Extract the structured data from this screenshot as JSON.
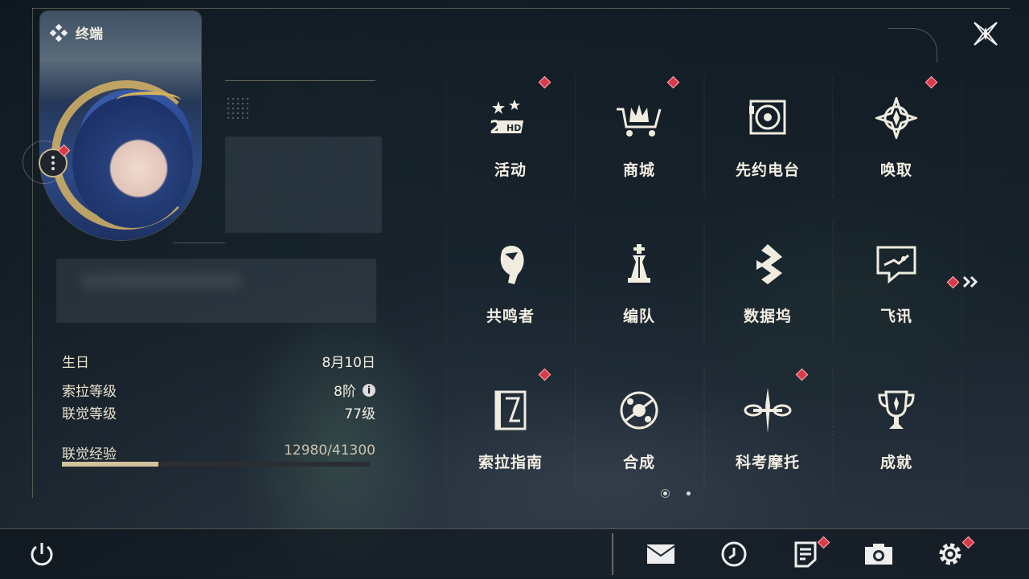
{
  "header": {
    "terminal_label": "终端"
  },
  "profile": {
    "birthday_label": "生日",
    "birthday_value": "8月10日",
    "sola_level_label": "索拉等级",
    "sola_level_value": "8阶",
    "union_level_label": "联觉等级",
    "union_level_value": "77级",
    "union_exp_label": "联觉经验",
    "union_exp_value": "12980/41300",
    "union_exp_progress": 0.314
  },
  "menu": [
    {
      "id": "events",
      "label": "活动",
      "icon": "events-2nd-anniversary-icon",
      "badge": true
    },
    {
      "id": "shop",
      "label": "商城",
      "icon": "shop-cart-icon",
      "badge": true
    },
    {
      "id": "radio",
      "label": "先约电台",
      "icon": "radio-vinyl-icon",
      "badge": false
    },
    {
      "id": "convene",
      "label": "唤取",
      "icon": "convene-compass-icon",
      "badge": true
    },
    {
      "id": "resonators",
      "label": "共鸣者",
      "icon": "resonator-portrait-icon",
      "badge": false
    },
    {
      "id": "team",
      "label": "编队",
      "icon": "team-chess-icon",
      "badge": false
    },
    {
      "id": "databank",
      "label": "数据坞",
      "icon": "databank-icon",
      "badge": false
    },
    {
      "id": "messages",
      "label": "飞讯",
      "icon": "chat-bubble-icon",
      "badge": false
    },
    {
      "id": "guidebook",
      "label": "索拉指南",
      "icon": "guidebook-icon",
      "badge": true
    },
    {
      "id": "synthesis",
      "label": "合成",
      "icon": "synthesis-icon",
      "badge": false
    },
    {
      "id": "motorcycle",
      "label": "科考摩托",
      "icon": "motorcycle-icon",
      "badge": true
    },
    {
      "id": "achievements",
      "label": "成就",
      "icon": "trophy-icon",
      "badge": false
    }
  ],
  "pagination": {
    "pages": 2,
    "current": 1
  },
  "bottom_bar": [
    {
      "id": "mail",
      "icon": "mail-icon",
      "badge": false
    },
    {
      "id": "clock",
      "icon": "clock-icon",
      "badge": false
    },
    {
      "id": "notice",
      "icon": "notice-icon",
      "badge": true
    },
    {
      "id": "camera",
      "icon": "camera-icon",
      "badge": false
    },
    {
      "id": "settings",
      "icon": "gear-icon",
      "badge": true
    }
  ],
  "colors": {
    "badge": "#d93a4a",
    "accent_gold": "#d2c39a",
    "text": "#f3eee2"
  }
}
